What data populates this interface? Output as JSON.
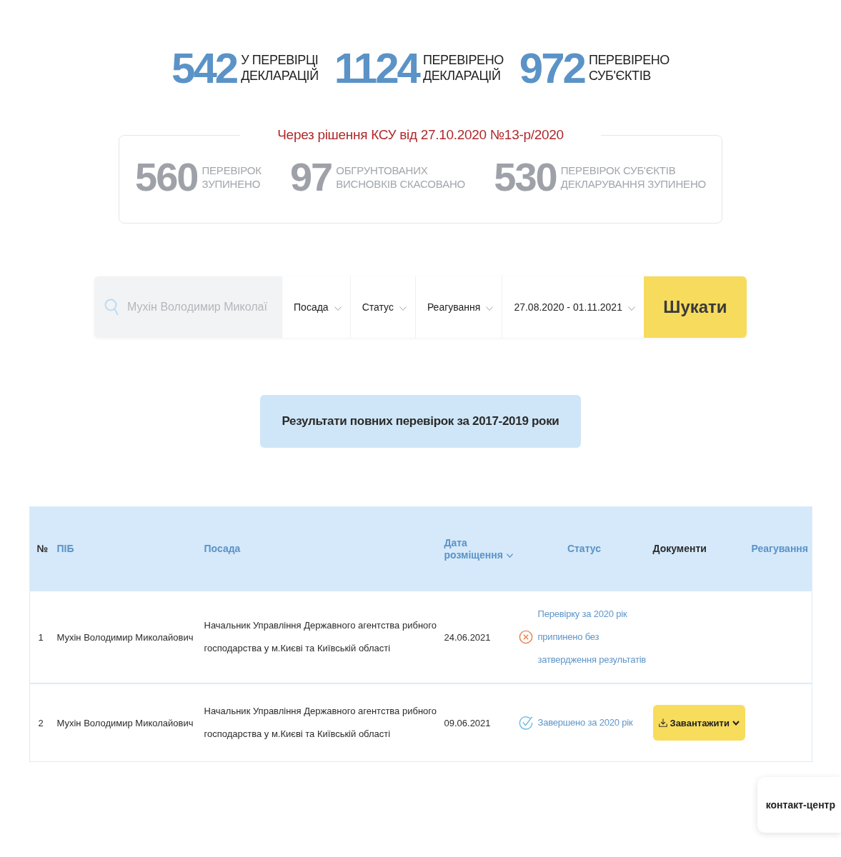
{
  "counters": [
    {
      "value": "542",
      "label_lines": [
        "У ПЕРЕВІРЦІ",
        "ДЕКЛАРАЦІЙ"
      ]
    },
    {
      "value": "1124",
      "label_lines": [
        "ПЕРЕВІРЕНО",
        "ДЕКЛАРАЦІЙ"
      ]
    },
    {
      "value": "972",
      "label_lines": [
        "ПЕРЕВІРЕНО",
        "СУБ'ЄКТІВ"
      ]
    }
  ],
  "suspended": {
    "caption": "Через рішення КСУ від 27.10.2020 №13-р/2020",
    "counters": [
      {
        "value": "560",
        "label_lines": [
          "ПЕРЕВІРОК",
          "ЗУПИНЕНО"
        ]
      },
      {
        "value": "97",
        "label_lines": [
          "ОБГРУНТОВАНИХ",
          "ВИСНОВКІВ СКАСОВАНО"
        ]
      },
      {
        "value": "530",
        "label_lines": [
          "ПЕРЕВІРОК СУБ'ЄКТІВ",
          "ДЕКЛАРУВАННЯ ЗУПИНЕНО"
        ]
      }
    ]
  },
  "search": {
    "placeholder": "Мухін Володимир Миколаї",
    "filters": [
      {
        "label": "Посада"
      },
      {
        "label": "Статус"
      },
      {
        "label": "Реагування"
      },
      {
        "label": "27.08.2020 - 01.11.2021"
      }
    ],
    "button": "Шукати"
  },
  "results_button": "Результати повних перевірок за 2017-2019 роки",
  "table": {
    "columns": [
      {
        "label": "№",
        "link": false,
        "sorted": false
      },
      {
        "label": "ПІБ",
        "link": true,
        "sorted": false
      },
      {
        "label": "Посада",
        "link": true,
        "sorted": false
      },
      {
        "label": "Дата розміщення",
        "link": true,
        "sorted": true
      },
      {
        "label": "Статус",
        "link": true,
        "sorted": false
      },
      {
        "label": "Документи",
        "link": false,
        "sorted": false
      },
      {
        "label": "Реагування",
        "link": true,
        "sorted": false
      }
    ],
    "rows": [
      {
        "number": "1",
        "name": "Мухін Володимир Миколайович",
        "position": "Начальник Управління Державного агентства рибного господарства у м.Києві та Київській області",
        "date": "24.06.2021",
        "status": {
          "kind": "stopped",
          "text": "Перевірку за 2020 рік припинено без затвердження результатів"
        }
      },
      {
        "number": "2",
        "name": "Мухін Володимир Миколайович",
        "position": "Начальник Управління Державного агентства рибного господарства у м.Києві та Київській області",
        "date": "09.06.2021",
        "status": {
          "kind": "done",
          "text": "Завершено за 2020 рік"
        },
        "download_button": "Завантажити"
      }
    ]
  },
  "contact_button": "контакт-центр"
}
